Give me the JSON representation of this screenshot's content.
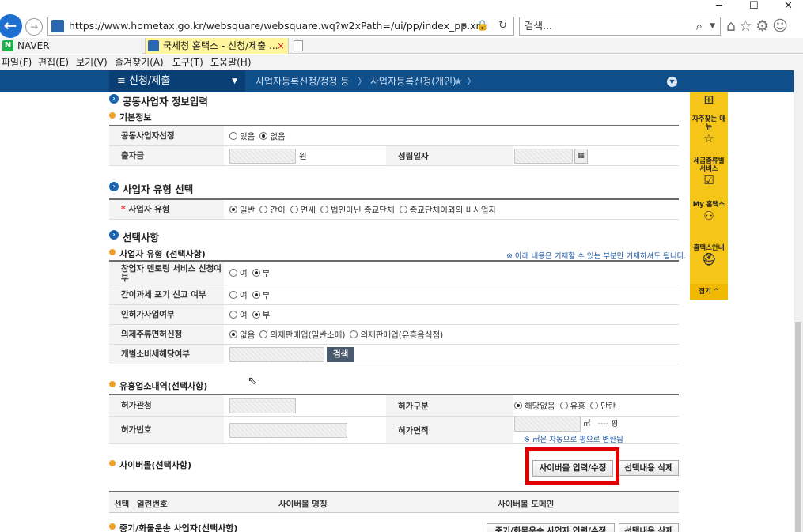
{
  "browser": {
    "url": "https://www.hometax.go.kr/websquare/websquare.wq?w2xPath=/ui/pp/index_pp.xml",
    "search_placeholder": "검색...",
    "tabs": [
      {
        "label": "NAVER",
        "icon": "naver-icon"
      },
      {
        "label": "국세청 홈택스 - 신청/제출 ...",
        "icon": "hometax-icon",
        "close": "×"
      }
    ],
    "menu": [
      "파일(F)",
      "편집(E)",
      "보기(V)",
      "즐겨찾기(A)",
      "도구(T)",
      "도움말(H)"
    ]
  },
  "nav": {
    "main": "≡  신청/제출",
    "crumbs": [
      "사업자등록신청/정정 등",
      "사업자등록신청(개인)"
    ]
  },
  "sidebar": {
    "items": [
      "자주찾는 메뉴",
      "세금종류별 서비스",
      "My 홈택스",
      "홈택스안내"
    ],
    "fold": "접기 ^"
  },
  "form": {
    "partner_section": "공동사업자 정보입력",
    "basic_info": "기본정보",
    "partner_select_label": "공동사업자선정",
    "partner_options": [
      "있음",
      "없음"
    ],
    "partner_selected": 1,
    "investment_label": "출자금",
    "investment_unit": "원",
    "established_label": "성립일자",
    "biztype_section": "사업자 유형 선택",
    "biztype_label": "사업자 유형",
    "biztype_options": [
      "일반",
      "간이",
      "면세",
      "법인아닌 종교단체",
      "종교단체이외의 비사업자"
    ],
    "biztype_selected": 0,
    "optional_section": "선택사항",
    "optional_sub": "사업자 유형 (선택사항)",
    "optional_note": "※ 아래 내용은 기재할 수 있는 부분만 기재하셔도 됩니다.",
    "mentoring_label": "창업자 멘토링 서비스 신청여부",
    "simple_tax_label": "간이과세 포기 신고 여부",
    "license_label": "인허가사업여부",
    "yes": "여",
    "no": "부",
    "liquor_label": "의제주류면허신청",
    "liquor_options": [
      "없음",
      "의제판매업(일반소매)",
      "의제판매업(유흥음식점)"
    ],
    "excise_label": "개별소비세해당여부",
    "search_btn": "검색",
    "entertain_sub": "유흥업소내역(선택사항)",
    "permit_office_label": "허가관청",
    "permit_type_label": "허가구분",
    "permit_type_options": [
      "해당없음",
      "유흥",
      "단란"
    ],
    "permit_no_label": "허가번호",
    "permit_area_label": "허가면적",
    "area_unit": "㎡",
    "area_pyeong": "---- 평",
    "area_note": "※ ㎡은 자동으로 평으로 변환됨",
    "cyber_sub": "사이버몰(선택사항)",
    "cyber_input_btn": "사이버몰 입력/수정",
    "cyber_delete_btn": "선택내용 삭제",
    "cyber_columns": [
      "선택",
      "일련번호",
      "사이버몰 명칭",
      "사이버몰 도메인"
    ],
    "cargo_sub": "중기/화물운송 사업자(선택사항)",
    "cargo_input_btn": "중기/화물운송 사업자 입력/수정",
    "cargo_delete_btn": "선택내용 삭제"
  },
  "colors": {
    "nav": "#0f4f8c",
    "sidebar": "#f5c518",
    "highlight": "#e00000",
    "section_bullet": "#1b64b0"
  }
}
